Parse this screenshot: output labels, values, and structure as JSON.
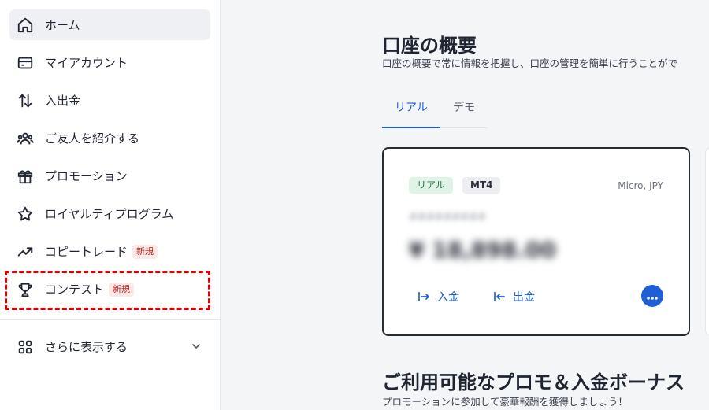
{
  "sidebar": {
    "items": [
      {
        "label": "ホーム",
        "icon": "home-icon"
      },
      {
        "label": "マイアカウント",
        "icon": "wallet-icon"
      },
      {
        "label": "入出金",
        "icon": "transfer-arrows-icon"
      },
      {
        "label": "ご友人を紹介する",
        "icon": "users-group-icon"
      },
      {
        "label": "プロモーション",
        "icon": "gift-icon"
      },
      {
        "label": "ロイヤルティプログラム",
        "icon": "star-icon"
      },
      {
        "label": "コピートレード",
        "icon": "trending-up-icon",
        "badge": "新規"
      },
      {
        "label": "コンテスト",
        "icon": "trophy-icon",
        "badge": "新規"
      }
    ],
    "more_label": "さらに表示する"
  },
  "main": {
    "title": "口座の概要",
    "subtitle": "口座の概要で常に情報を把握し、口座の管理を簡単に行うことがで",
    "tabs": [
      {
        "label": "リアル",
        "active": true
      },
      {
        "label": "デモ",
        "active": false
      }
    ],
    "account_card": {
      "type_tag": "リアル",
      "platform_tag": "MT4",
      "meta": "Micro, JPY",
      "blurred_label": "#########",
      "blurred_balance": "¥ 18,898.00",
      "deposit_label": "入金",
      "withdraw_label": "出金"
    },
    "promo": {
      "title": "ご利用可能なプロモ＆入金ボーナス",
      "subtitle": "プロモーションに参加して豪華報酬を獲得しましょう！"
    }
  },
  "colors": {
    "accent": "#1f5fd6",
    "highlight_border": "#e00000",
    "badge_text": "#b3261e",
    "badge_bg": "#fde8e8",
    "real_tag_bg": "#dff4e6"
  }
}
